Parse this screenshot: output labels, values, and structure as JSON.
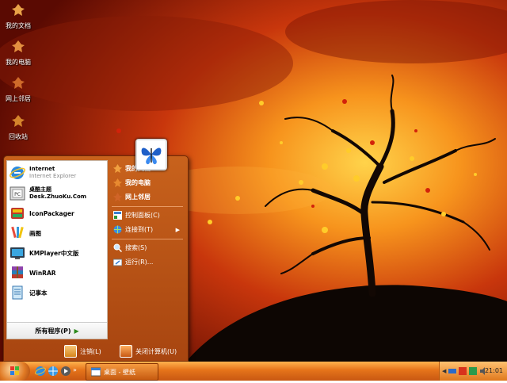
{
  "desktop": {
    "icons": [
      {
        "label": "我的文档",
        "icon": "my-documents-icon"
      },
      {
        "label": "我的电脑",
        "icon": "my-computer-icon"
      },
      {
        "label": "网上邻居",
        "icon": "network-places-icon"
      },
      {
        "label": "回收站",
        "icon": "recycle-bin-icon"
      }
    ]
  },
  "start_menu": {
    "pinned": [
      {
        "title": "Internet",
        "subtitle": "Internet Explorer",
        "icon": "internet-explorer-icon"
      },
      {
        "title": "桌酷主题",
        "subtitle": "Desk.ZhuoKu.Com",
        "icon": "zhuoku-theme-icon"
      }
    ],
    "programs": [
      {
        "title": "IconPackager",
        "icon": "iconpackager-icon"
      },
      {
        "title": "画图",
        "icon": "paint-icon"
      },
      {
        "title": "KMPlayer中文版",
        "icon": "kmplayer-icon"
      },
      {
        "title": "WinRAR",
        "icon": "winrar-icon"
      },
      {
        "title": "记事本",
        "icon": "notepad-icon"
      }
    ],
    "all_programs": "所有程序(P)",
    "right": {
      "my_documents": "我的文档",
      "my_computer": "我的电脑",
      "network": "网上邻居",
      "control_panel": "控制面板(C)",
      "connect_to": "连接到(T)",
      "search": "搜索(S)",
      "run": "运行(R)..."
    },
    "logoff": "注销(L)",
    "shutdown": "关闭计算机(U)"
  },
  "taskbar": {
    "window_title": "桌面 - 壁纸",
    "clock": "21:01"
  },
  "colors": {
    "taskbar": "#e5731a",
    "start_menu": "#b84e14"
  }
}
